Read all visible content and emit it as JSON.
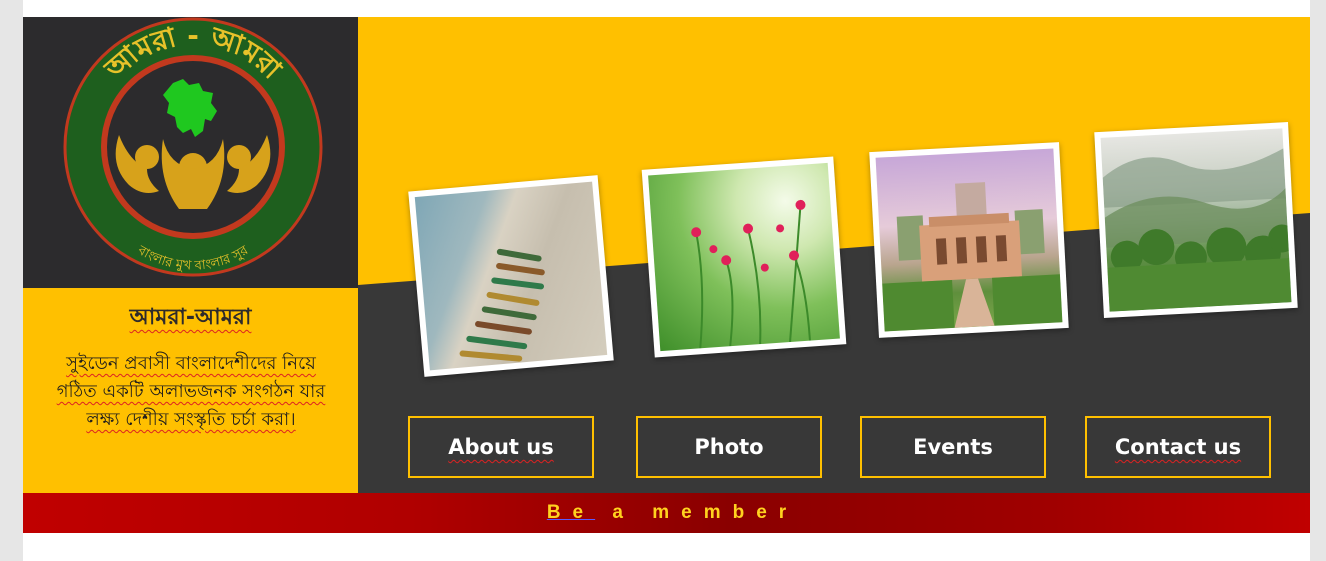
{
  "logo": {
    "top_text": "আমরা - আমরা",
    "bottom_text": "বাংলার মুখ    বাংলার সুর"
  },
  "org": {
    "name": "আমরা-আমরা",
    "description": "সুইডেন প্রবাসী বাংলাদেশীদের নিয়ে গঠিত একটি অলাভজনক সংগঠন যার লক্ষ্য দেশীয় সংস্কৃতি চর্চা করা।"
  },
  "photos": [
    {
      "name": "beach-boats-photo"
    },
    {
      "name": "red-flowers-photo"
    },
    {
      "name": "lalbagh-fort-photo"
    },
    {
      "name": "misty-hills-photo"
    }
  ],
  "nav": {
    "about": "About us",
    "photo": "Photo",
    "events": "Events",
    "contact": "Contact us"
  },
  "member": {
    "label_first": "Be",
    "label_rest": " a member"
  },
  "colors": {
    "accent_yellow": "#ffc000",
    "dark": "#383838",
    "logo_green": "#1e6b1e",
    "member_red": "#c00000",
    "member_text": "#ffd21f"
  }
}
